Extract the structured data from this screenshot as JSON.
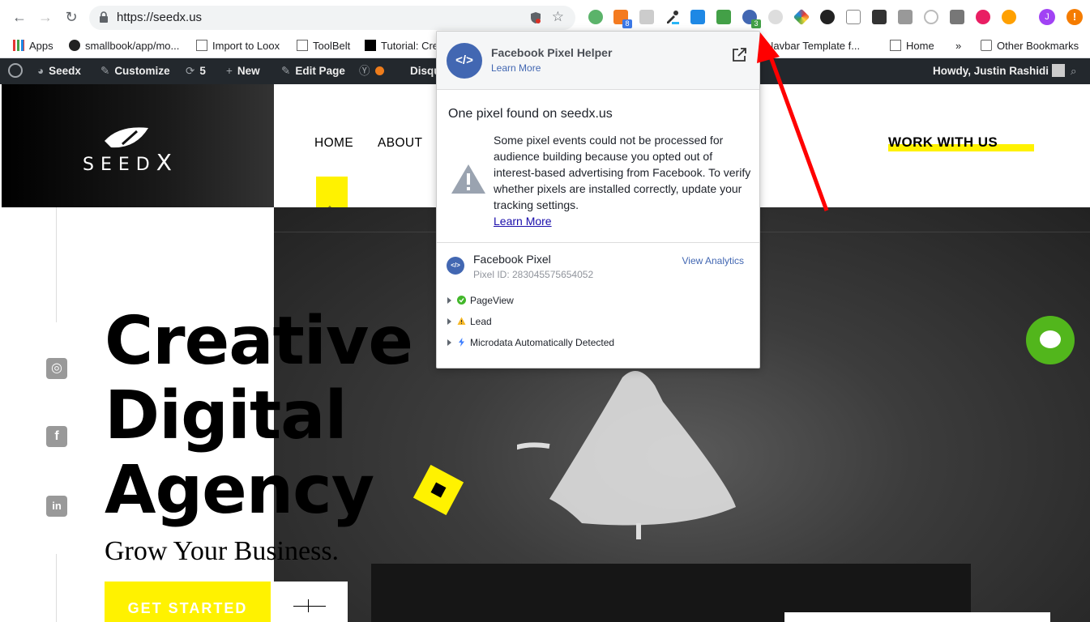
{
  "browser": {
    "url": "https://seedx.us",
    "profile_initial": "J",
    "alert_symbol": "!",
    "extension_badges": {
      "ext_one": "8",
      "ext_pixel": "3"
    }
  },
  "bookmarks": {
    "items": [
      "Apps",
      "smallbook/app/mo...",
      "Import to Loox",
      "ToolBelt",
      "Tutorial: Cre",
      "Navbar Template f...",
      "Home"
    ],
    "overflow": "»",
    "other": "Other Bookmarks"
  },
  "wp_admin": {
    "site": "Seedx",
    "customize": "Customize",
    "updates_count": "5",
    "new": "New",
    "edit_page": "Edit Page",
    "disqus": "Disqu",
    "howdy": "Howdy, Justin Rashidi"
  },
  "site": {
    "logo_text": "SEED",
    "logo_x": "X",
    "menu": [
      "HOME",
      "ABOUT"
    ],
    "cta_nav": "WORK WITH US",
    "hero_lines": [
      "Creative",
      "Digital",
      "Agency"
    ],
    "tagline": "Grow Your Business.",
    "button": "GET STARTED"
  },
  "popup": {
    "title": "Facebook Pixel Helper",
    "learn_more": "Learn More",
    "found": "One pixel found on seedx.us",
    "warning": "Some pixel events could not be processed for audience building because you opted out of interest-based advertising from Facebook. To verify whether pixels are installed correctly, update your tracking settings.",
    "warning_link": "Learn More",
    "pixel_name": "Facebook Pixel",
    "pixel_id": "Pixel ID: 283045575654052",
    "view_analytics": "View Analytics",
    "events": [
      {
        "label": "PageView",
        "status": "ok"
      },
      {
        "label": "Lead",
        "status": "warning"
      },
      {
        "label": "Microdata Automatically Detected",
        "status": "info"
      }
    ]
  },
  "colors": {
    "accent_yellow": "#fff200",
    "facebook_blue": "#4267b2",
    "wp_bar": "#23282d",
    "chat_green": "#52b61c",
    "annotation_red": "#ff0000"
  }
}
